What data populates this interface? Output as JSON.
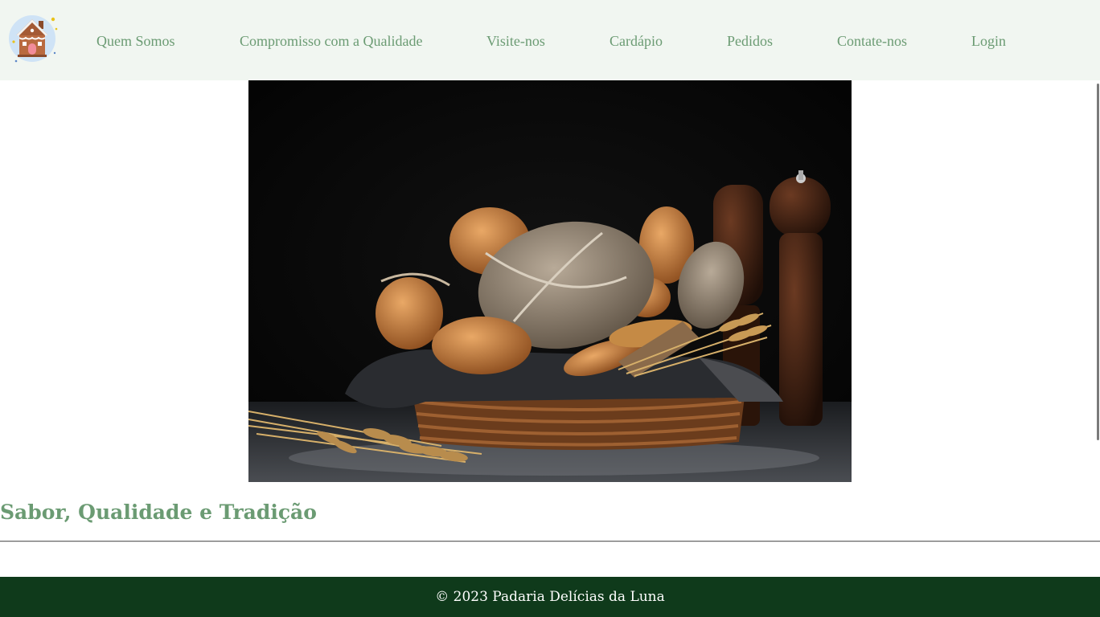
{
  "header": {
    "logo_icon": "gingerbread-house-icon",
    "nav": [
      "Quem Somos",
      "Compromisso com a Qualidade",
      "Visite-nos",
      "Cardápio",
      "Pedidos",
      "Contate-nos",
      "Login"
    ]
  },
  "hero": {
    "image": "bread-basket-photo"
  },
  "main": {
    "headline": "Sabor, Qualidade e Tradição"
  },
  "footer": {
    "copyright": "© 2023 Padaria Delícias da Luna"
  },
  "colors": {
    "header_bg": "#f1f6f1",
    "nav_text": "#6b9b73",
    "headline": "#6b9b73",
    "footer_bg": "#0f3a1b",
    "footer_text": "#ffffff"
  }
}
